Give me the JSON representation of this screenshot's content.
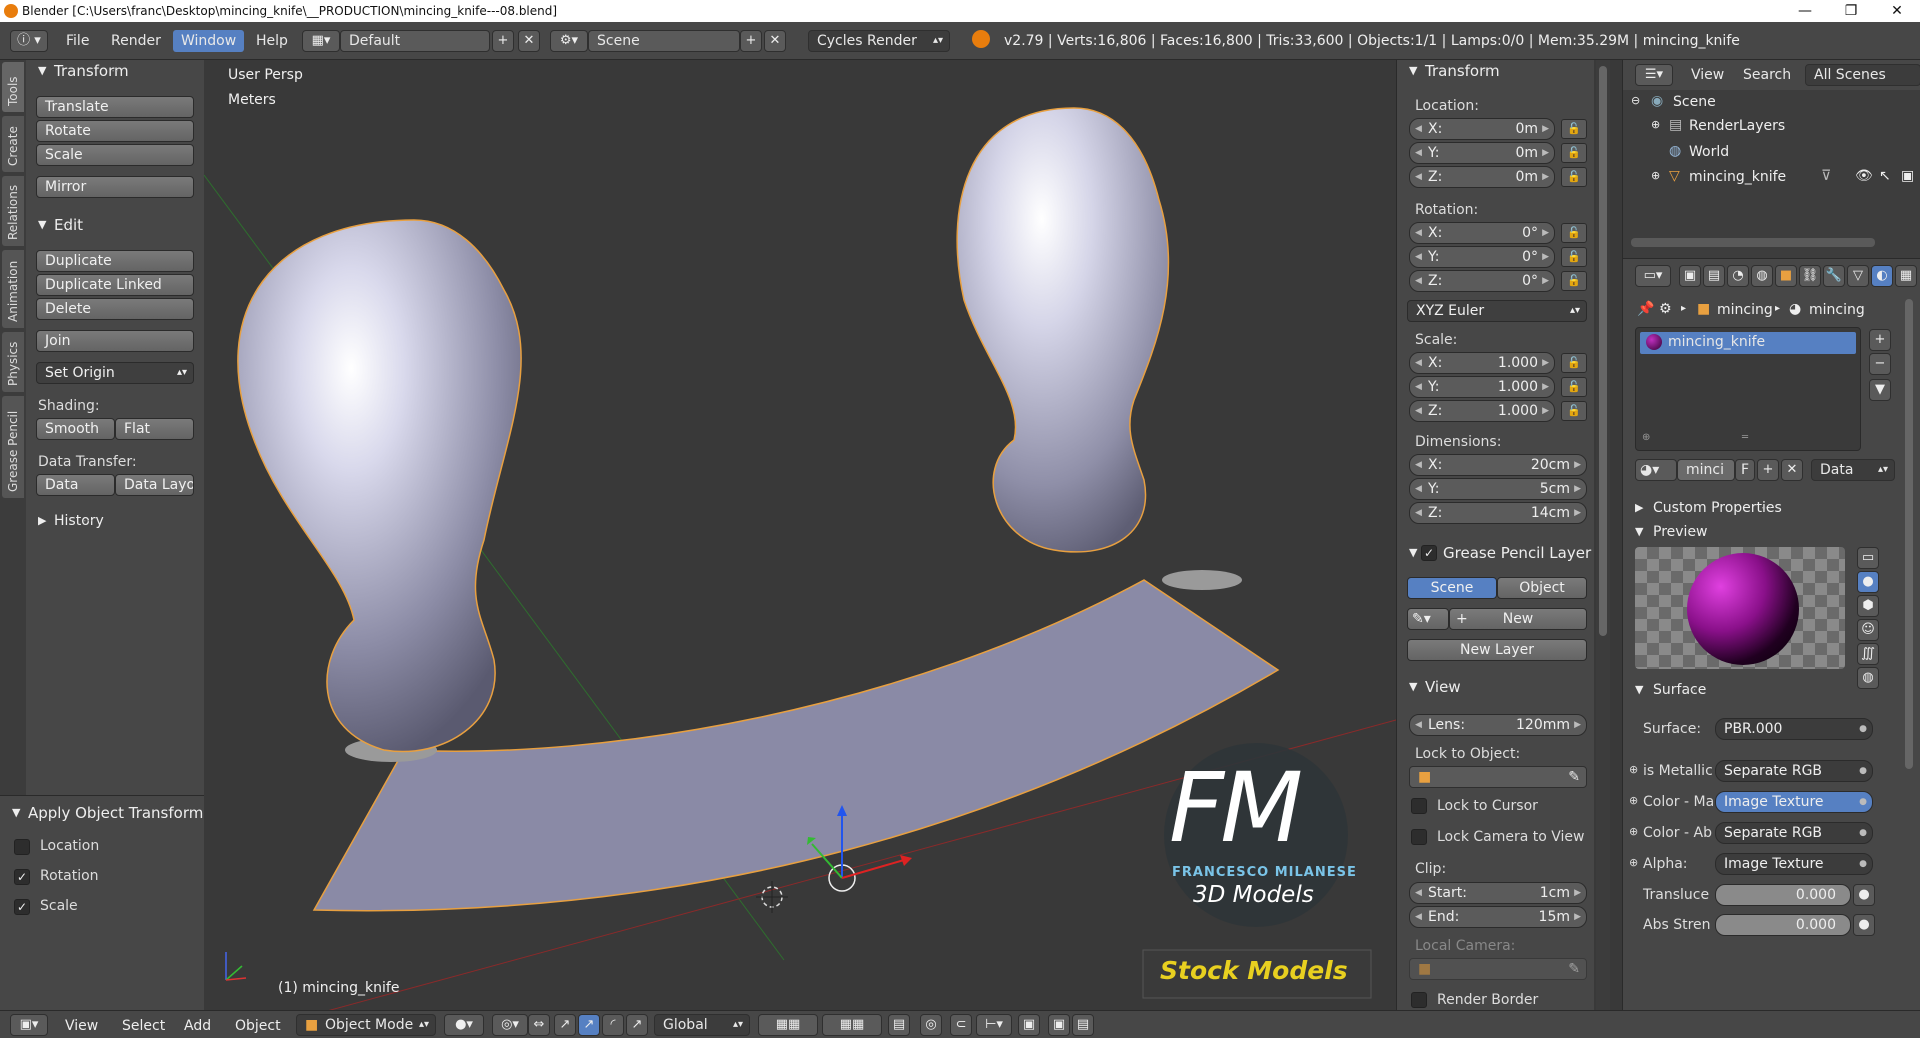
{
  "window": {
    "title": "Blender [C:\\Users\\franc\\Desktop\\mincing_knife\\__PRODUCTION\\mincing_knife---08.blend]",
    "minimize": "—",
    "maximize": "❐",
    "close": "✕"
  },
  "menubar": {
    "items": [
      "File",
      "Render",
      "Window",
      "Help"
    ],
    "active_item": "Window",
    "screen_layout": "Default",
    "scene": "Scene",
    "render_engine": "Cycles Render",
    "info": "v2.79 | Verts:16,806 | Faces:16,800 | Tris:33,600 | Objects:1/1 | Lamps:0/0 | Mem:35.29M | mincing_knife"
  },
  "left_tabs": [
    "Tools",
    "Create",
    "Relations",
    "Animation",
    "Physics",
    "Grease Pencil"
  ],
  "tool_shelf": {
    "transform_header": "Transform",
    "translate": "Translate",
    "rotate": "Rotate",
    "scale": "Scale",
    "mirror": "Mirror",
    "edit_header": "Edit",
    "duplicate": "Duplicate",
    "duplicate_linked": "Duplicate Linked",
    "delete": "Delete",
    "join": "Join",
    "set_origin": "Set Origin",
    "shading_label": "Shading:",
    "smooth": "Smooth",
    "flat": "Flat",
    "data_transfer_label": "Data Transfer:",
    "data": "Data",
    "data_layout": "Data Layo",
    "history_header": "History"
  },
  "operator_panel": {
    "header": "Apply Object Transform",
    "location": {
      "label": "Location",
      "checked": false
    },
    "rotation": {
      "label": "Rotation",
      "checked": true
    },
    "scale": {
      "label": "Scale",
      "checked": true
    }
  },
  "viewport": {
    "view_name": "User Persp",
    "units": "Meters",
    "object_label": "(1) mincing_knife",
    "watermark_initials": "FM",
    "watermark_name": "FRANCESCO MILANESE",
    "watermark_sub": "3D Models",
    "watermark_banner": "Stock Models",
    "colors": {
      "background": "#393939",
      "knife": "#c8c8dc",
      "outline": "#e8a040",
      "banner_text": "#e8d020"
    }
  },
  "n_panel": {
    "transform_header": "Transform",
    "location_label": "Location:",
    "location": {
      "x": "0m",
      "y": "0m",
      "z": "0m"
    },
    "rotation_label": "Rotation:",
    "rotation": {
      "x": "0°",
      "y": "0°",
      "z": "0°"
    },
    "rotation_mode": "XYZ Euler",
    "scale_label": "Scale:",
    "scale": {
      "x": "1.000",
      "y": "1.000",
      "z": "1.000"
    },
    "dimensions_label": "Dimensions:",
    "dimensions": {
      "x": "20cm",
      "y": "5cm",
      "z": "14cm"
    },
    "grease_pencil_header": "Grease Pencil Layer",
    "scene_tab": "Scene",
    "object_tab": "Object",
    "new_btn": "New",
    "new_layer_btn": "New Layer",
    "view_header": "View",
    "lens_label": "Lens:",
    "lens_value": "120mm",
    "lock_to_object_label": "Lock to Object:",
    "lock_to_cursor": "Lock to Cursor",
    "lock_camera_to_view": "Lock Camera to View",
    "clip_label": "Clip:",
    "clip_start_label": "Start:",
    "clip_start": "1cm",
    "clip_end_label": "End:",
    "clip_end": "15m",
    "local_camera_label": "Local Camera:",
    "render_border": "Render Border",
    "axis_x": "X:",
    "axis_y": "Y:",
    "axis_z": "Z:"
  },
  "outliner": {
    "view": "View",
    "search": "Search",
    "filter": "All Scenes",
    "items": [
      "Scene",
      "RenderLayers",
      "World",
      "mincing_knife"
    ]
  },
  "properties": {
    "breadcrumb_1": "mincing",
    "breadcrumb_2": "mincing",
    "material_slot": "mincing_knife",
    "mat_name_short": "minci",
    "fake_user": "F",
    "link_mode": "Data",
    "custom_properties": "Custom Properties",
    "preview": "Preview",
    "surface_header": "Surface",
    "surface_label": "Surface:",
    "surface_value": "PBR.000",
    "rows": [
      {
        "label": "is Metallic",
        "value": "Separate RGB"
      },
      {
        "label": "Color - Ma",
        "value": "Image Texture"
      },
      {
        "label": "Color - Ab",
        "value": "Separate RGB"
      },
      {
        "label": "Alpha:",
        "value": "Image Texture"
      }
    ],
    "translucence_label": "Transluce",
    "translucence_value": "0.000",
    "abs_strength_label": "Abs Stren",
    "abs_strength_value": "0.000"
  },
  "bottombar": {
    "view": "View",
    "select": "Select",
    "add": "Add",
    "object": "Object",
    "mode": "Object Mode",
    "orientation": "Global"
  }
}
